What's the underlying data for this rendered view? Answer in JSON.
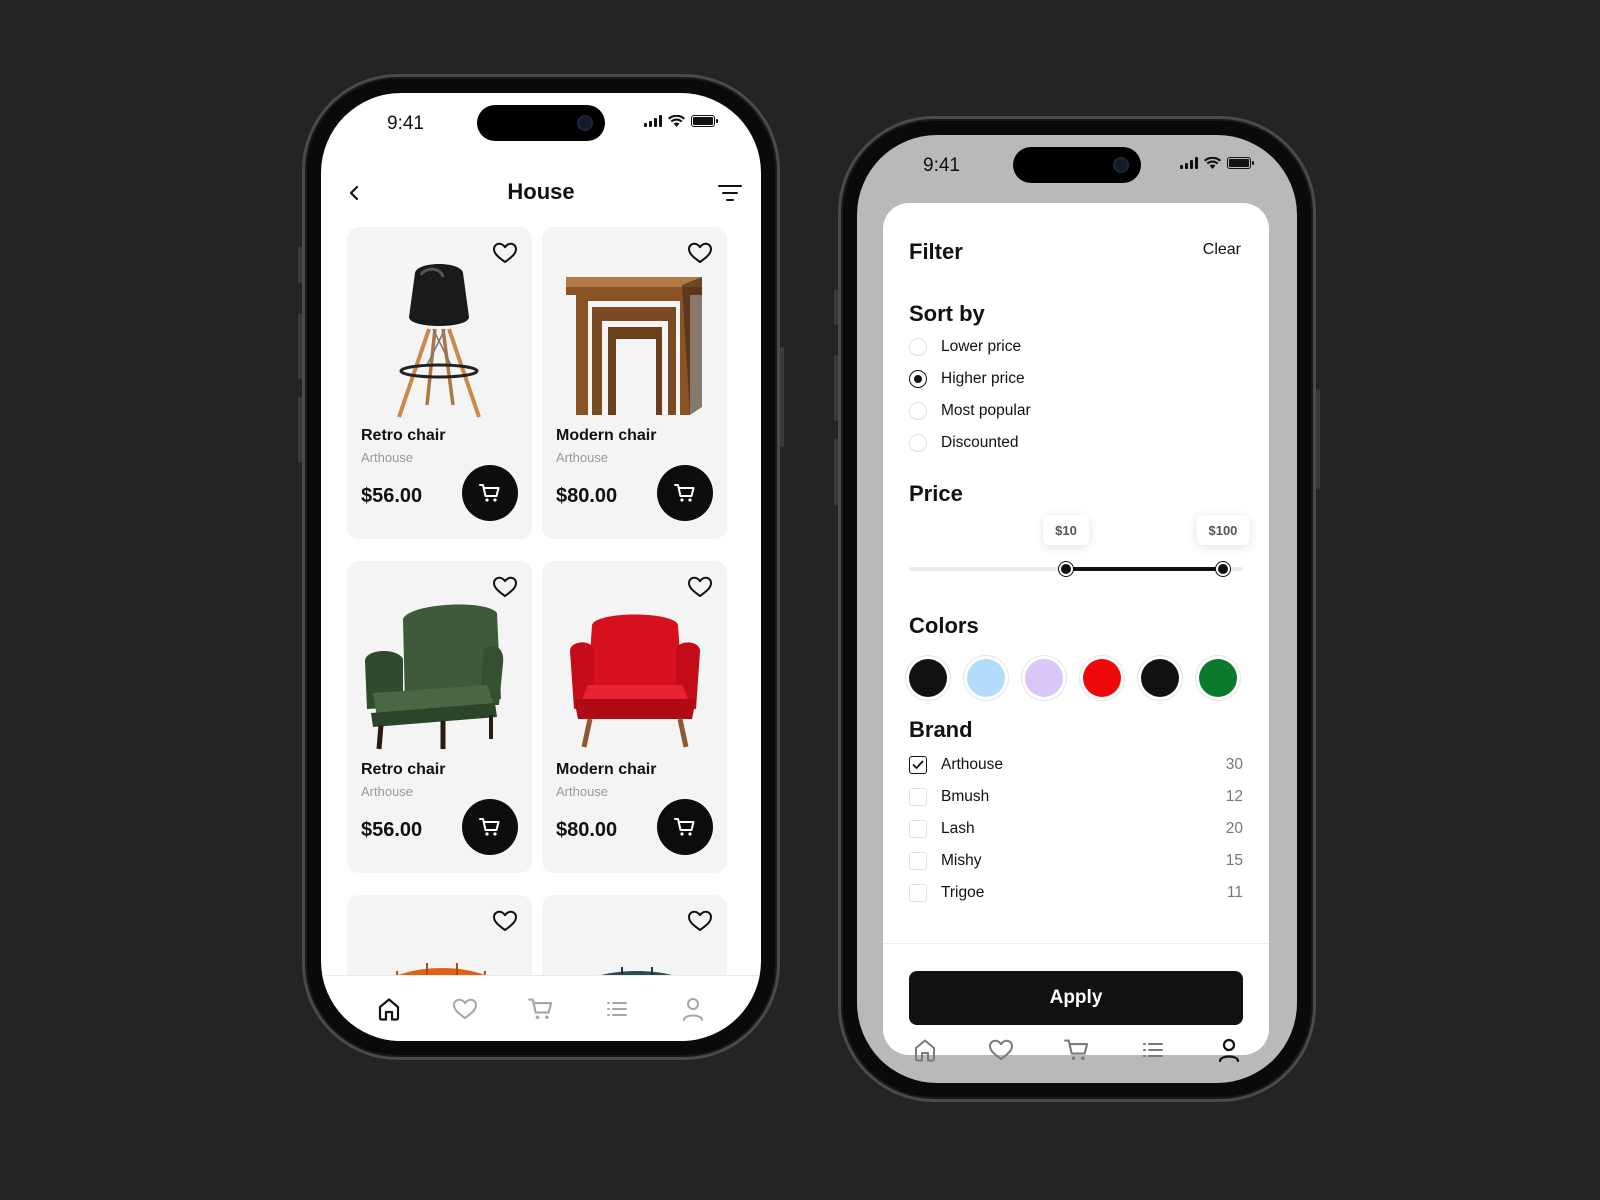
{
  "status": {
    "time": "9:41"
  },
  "catalog": {
    "title": "House",
    "products": [
      {
        "name": "Retro chair",
        "brand": "Arthouse",
        "price": "$56.00"
      },
      {
        "name": "Modern chair",
        "brand": "Arthouse",
        "price": "$80.00"
      },
      {
        "name": "Retro chair",
        "brand": "Arthouse",
        "price": "$56.00"
      },
      {
        "name": "Modern chair",
        "brand": "Arthouse",
        "price": "$80.00"
      }
    ]
  },
  "filter": {
    "title": "Filter",
    "clear_label": "Clear",
    "sort_title": "Sort by",
    "sort_options": [
      "Lower price",
      "Higher price",
      "Most popular",
      "Discounted"
    ],
    "sort_selected": "Higher price",
    "price_title": "Price",
    "price_min_label": "$10",
    "price_max_label": "$100",
    "price_range_fraction": [
      0.47,
      0.94
    ],
    "colors_title": "Colors",
    "colors": [
      "#111111",
      "#b3dcfb",
      "#d8c7f7",
      "#ee0a0a",
      "#111111",
      "#0c7a2c"
    ],
    "brand_title": "Brand",
    "brands": [
      {
        "name": "Arthouse",
        "count": "30",
        "checked": true
      },
      {
        "name": "Bmush",
        "count": "12",
        "checked": false
      },
      {
        "name": "Lash",
        "count": "20",
        "checked": false
      },
      {
        "name": "Mishy",
        "count": "15",
        "checked": false
      },
      {
        "name": "Trigoe",
        "count": "11",
        "checked": false
      }
    ],
    "apply_label": "Apply"
  },
  "tabs": [
    "home-icon",
    "heart-icon",
    "cart-icon",
    "list-icon",
    "user-icon"
  ]
}
